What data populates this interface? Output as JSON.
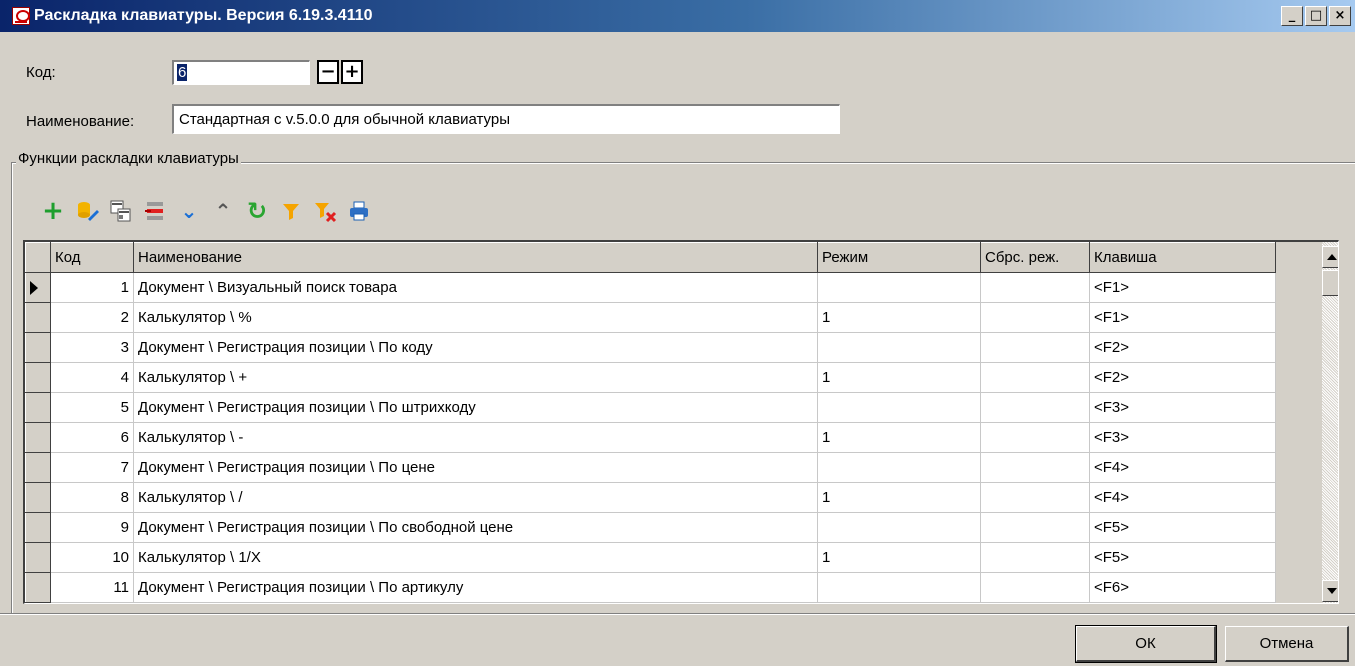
{
  "window": {
    "title": "Раскладка клавиатуры. Версия 6.19.3.4110",
    "controls": {
      "minimize": "_",
      "maximize": "□",
      "close": "×"
    }
  },
  "form": {
    "code_label": "Код:",
    "code_value": "6",
    "minus": "−",
    "plus": "+",
    "name_label": "Наименование:",
    "name_value": "Стандартная с v.5.0.0 для обычной клавиатуры"
  },
  "group": {
    "legend": "Функции раскладки клавиатуры",
    "toolbar": [
      "add-icon",
      "edit-icon",
      "copy-icon",
      "delete-icon",
      "move-down-icon",
      "move-up-icon",
      "refresh-icon",
      "filter-icon",
      "clear-filter-icon",
      "print-icon"
    ]
  },
  "grid": {
    "columns": [
      "Код",
      "Наименование",
      "Режим",
      "Сбрс. реж.",
      "Клавиша"
    ],
    "rows": [
      [
        "1",
        "Документ \\ Визуальный поиск товара",
        "",
        "",
        "<F1>"
      ],
      [
        "2",
        "Калькулятор \\ %",
        "1",
        "",
        "<F1>"
      ],
      [
        "3",
        "Документ \\ Регистрация позиции \\ По коду",
        "",
        "",
        "<F2>"
      ],
      [
        "4",
        "Калькулятор \\ +",
        "1",
        "",
        "<F2>"
      ],
      [
        "5",
        "Документ \\ Регистрация позиции \\ По штрихкоду",
        "",
        "",
        "<F3>"
      ],
      [
        "6",
        "Калькулятор \\ -",
        "1",
        "",
        "<F3>"
      ],
      [
        "7",
        "Документ \\ Регистрация позиции \\ По цене",
        "",
        "",
        "<F4>"
      ],
      [
        "8",
        "Калькулятор \\ /",
        "1",
        "",
        "<F4>"
      ],
      [
        "9",
        "Документ \\ Регистрация позиции \\ По свободной цене",
        "",
        "",
        "<F5>"
      ],
      [
        "10",
        "Калькулятор \\ 1/X",
        "1",
        "",
        "<F5>"
      ],
      [
        "11",
        "Документ \\ Регистрация позиции \\ По артикулу",
        "",
        "",
        "<F6>"
      ]
    ]
  },
  "buttons": {
    "ok": "ОК",
    "cancel": "Отмена"
  }
}
